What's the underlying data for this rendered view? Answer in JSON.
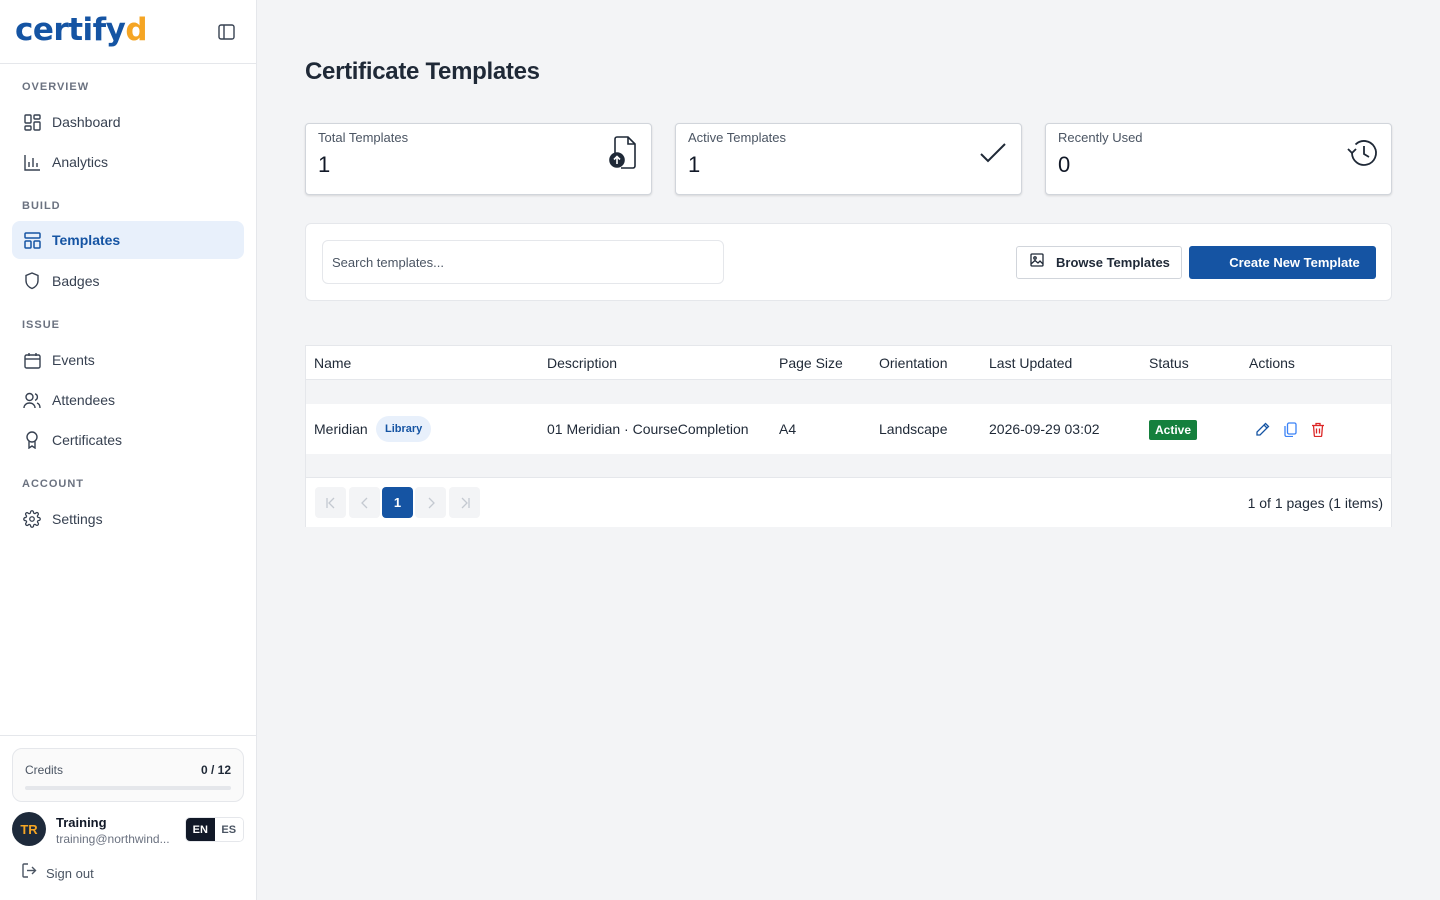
{
  "brand": {
    "logo_main": "certify",
    "logo_accent": "d"
  },
  "sidebar": {
    "sections": [
      {
        "label": "OVERVIEW"
      },
      {
        "label": "BUILD"
      },
      {
        "label": "ISSUE"
      },
      {
        "label": "ACCOUNT"
      }
    ],
    "items": [
      {
        "label": "Dashboard",
        "icon": "dashboard-icon"
      },
      {
        "label": "Analytics",
        "icon": "bar-chart-icon"
      },
      {
        "label": "Templates",
        "icon": "templates-icon",
        "active": true
      },
      {
        "label": "Badges",
        "icon": "shield-icon"
      },
      {
        "label": "Events",
        "icon": "calendar-icon"
      },
      {
        "label": "Attendees",
        "icon": "users-icon"
      },
      {
        "label": "Certificates",
        "icon": "award-icon"
      },
      {
        "label": "Settings",
        "icon": "gear-icon"
      }
    ],
    "credits": {
      "label": "Credits",
      "value": "0 / 12",
      "used_fraction": 0
    },
    "user": {
      "initials": "TR",
      "name": "Training",
      "email": "training@northwind..."
    },
    "languages": [
      "EN",
      "ES"
    ],
    "active_language": "EN",
    "sign_out": "Sign out"
  },
  "page": {
    "title": "Certificate Templates"
  },
  "stats": [
    {
      "label": "Total Templates",
      "value": "1",
      "icon": "file-upload-icon"
    },
    {
      "label": "Active Templates",
      "value": "1",
      "icon": "check-icon"
    },
    {
      "label": "Recently Used",
      "value": "0",
      "icon": "history-icon"
    }
  ],
  "toolbar": {
    "search_placeholder": "Search templates...",
    "browse_label": "Browse Templates",
    "create_label": "Create New Template"
  },
  "table": {
    "columns": [
      "Name",
      "Description",
      "Page Size",
      "Orientation",
      "Last Updated",
      "Status",
      "Actions"
    ],
    "rows": [
      {
        "name": "Meridian",
        "tag": "Library",
        "description": "01 Meridian · CourseCompletion",
        "page_size": "A4",
        "orientation": "Landscape",
        "last_updated": "2026-09-29 03:02",
        "status": "Active"
      }
    ],
    "pagination": {
      "current_page": "1",
      "info": "1 of 1 pages (1 items)"
    }
  },
  "colors": {
    "brand": "#1554a3",
    "accent": "#f5a524",
    "success": "#15803d",
    "danger": "#dc2626"
  }
}
